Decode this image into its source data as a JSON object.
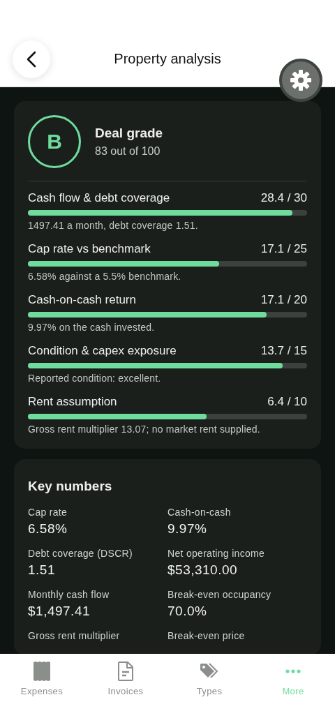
{
  "header": {
    "title": "Property analysis"
  },
  "grade": {
    "letter": "B",
    "title": "Deal grade",
    "score": "83 out of 100"
  },
  "factors": [
    {
      "label": "Cash flow & debt coverage",
      "points": "28.4 / 30",
      "level": 0.947,
      "note": "1497.41 a month, debt coverage 1.51."
    },
    {
      "label": "Cap rate vs benchmark",
      "points": "17.1 / 25",
      "level": 0.684,
      "note": "6.58% against a 5.5% benchmark."
    },
    {
      "label": "Cash-on-cash return",
      "points": "17.1 / 20",
      "level": 0.855,
      "note": "9.97% on the cash invested."
    },
    {
      "label": "Condition & capex exposure",
      "points": "13.7 / 15",
      "level": 0.913,
      "note": "Reported condition: excellent."
    },
    {
      "label": "Rent assumption",
      "points": "6.4 / 10",
      "level": 0.64,
      "note": "Gross rent multiplier 13.07; no market rent supplied."
    }
  ],
  "key_numbers": {
    "title": "Key numbers",
    "items": [
      {
        "label": "Cap rate",
        "value": "6.58%"
      },
      {
        "label": "Cash-on-cash",
        "value": "9.97%"
      },
      {
        "label": "Debt coverage (DSCR)",
        "value": "1.51"
      },
      {
        "label": "Net operating income",
        "value": "$53,310.00"
      },
      {
        "label": "Monthly cash flow",
        "value": "$1,497.41"
      },
      {
        "label": "Break-even occupancy",
        "value": "70.0%"
      },
      {
        "label": "Gross rent multiplier"
      },
      {
        "label": "Break-even price"
      }
    ]
  },
  "tabs": [
    {
      "label": "Expenses",
      "selected": false
    },
    {
      "label": "Invoices",
      "selected": false
    },
    {
      "label": "Types",
      "selected": false
    },
    {
      "label": "More",
      "selected": true
    }
  ]
}
